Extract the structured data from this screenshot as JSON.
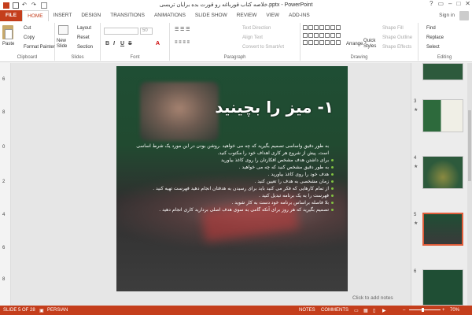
{
  "title": "خلاصه کتاب قورباغه رو قورت بده برایان تریسی.pptx - PowerPoint",
  "signin": "Sign in",
  "menu": {
    "file": "FILE",
    "tabs": [
      "HOME",
      "INSERT",
      "DESIGN",
      "TRANSITIONS",
      "ANIMATIONS",
      "SLIDE SHOW",
      "REVIEW",
      "VIEW",
      "ADD-INS"
    ]
  },
  "ribbon": {
    "clipboard": {
      "paste": "Paste",
      "cut": "Cut",
      "copy": "Copy",
      "format_painter": "Format Painter",
      "label": "Clipboard"
    },
    "slides": {
      "new_slide": "New Slide",
      "layout": "Layout",
      "reset": "Reset",
      "section": "Section",
      "label": "Slides"
    },
    "font": {
      "size": "50",
      "label": "Font"
    },
    "paragraph": {
      "text_direction": "Text Direction",
      "align_text": "Align Text",
      "convert_smartart": "Convert to SmartArt",
      "label": "Paragraph"
    },
    "drawing": {
      "arrange": "Arrange",
      "quick_styles": "Quick Styles",
      "shape_fill": "Shape Fill",
      "shape_outline": "Shape Outline",
      "shape_effects": "Shape Effects",
      "label": "Drawing"
    },
    "editing": {
      "find": "Find",
      "replace": "Replace",
      "select": "Select",
      "label": "Editing"
    }
  },
  "left_numbers": [
    "6",
    "8",
    "0",
    "2",
    "4",
    "6",
    "8"
  ],
  "slide": {
    "heading": "۱- میز را بچینید",
    "bullets": [
      "به طور دقیق واساسی تصمیم بگیرید که چه می خواهید .روشن بودن در این مورد یک شرط اساسی است. پیش از شروع هر کاری اهداف خود را مکتوب کنید.",
      "برای داشتن هدف مشخص افکارتان را روی کاغذ بیاورید",
      "به طور دقیق مشخص کنید که چه می خواهید .",
      "هدف خود را روی کاغذ بیاورید .",
      "زمان مشخصی به هدف را تعیین کنید .",
      "از تمام کارهایی که فکر می کنید باید برای رسیدن به هدفتان انجام دهید فهرست تهیه کنید .",
      "فهرست را به یک برنامه تبدیل کنید .",
      "بلا فاصله براساس برنامه خود دست به کار شوید .",
      "تصمیم بگیرید که هر روز برای آنکه گامی به سوی هدف اصلی بردارید کاری انجام دهید ."
    ]
  },
  "notes_placeholder": "Click to add notes",
  "thumbnails": [
    {
      "num": "",
      "star": ""
    },
    {
      "num": "3",
      "star": "★"
    },
    {
      "num": "4",
      "star": "★"
    },
    {
      "num": "5",
      "star": "★"
    },
    {
      "num": "6",
      "star": ""
    }
  ],
  "status": {
    "slide": "SLIDE 5 OF 28",
    "language": "PERSIAN",
    "notes": "NOTES",
    "comments": "COMMENTS",
    "zoom": "70%"
  },
  "colors": {
    "accent": "#c43e1c",
    "bullet": "#82c341",
    "selected_thumb": "#e05d3a"
  }
}
